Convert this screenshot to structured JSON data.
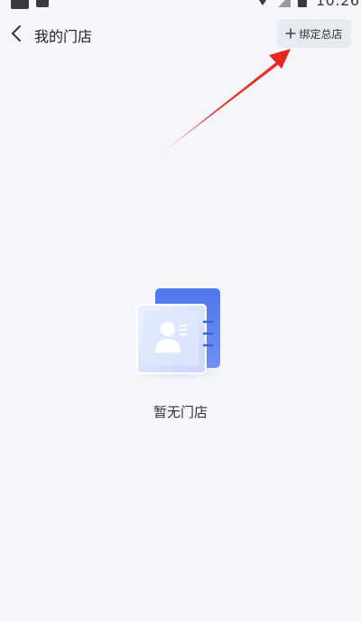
{
  "status_bar": {
    "time": "10:26"
  },
  "header": {
    "title": "我的门店",
    "back_icon": "chevron-left-icon",
    "bind_button_label": "绑定总店",
    "bind_button_icon": "plus-icon"
  },
  "empty_state": {
    "message": "暂无门店",
    "icon": "store-card-illustration"
  },
  "colors": {
    "background": "#f4f6fb",
    "accent_blue": "#5b7ff0",
    "annotation_red": "#e8261d",
    "button_bg": "#e7eaf0"
  }
}
